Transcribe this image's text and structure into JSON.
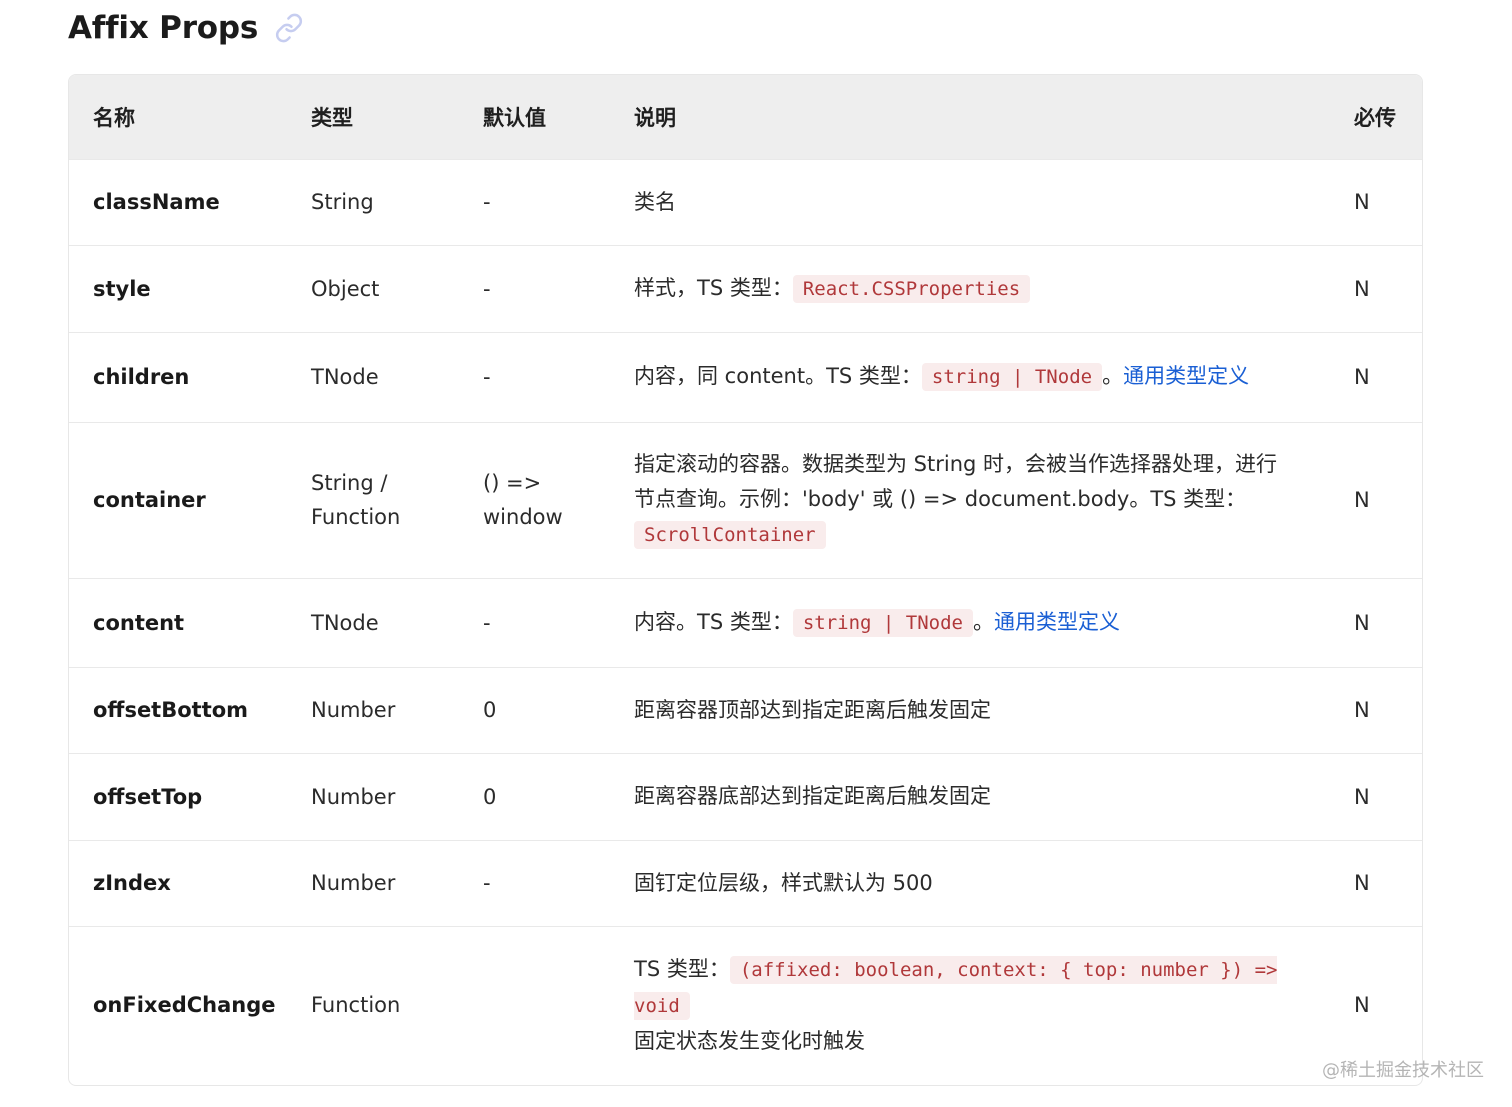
{
  "page": {
    "title": "Affix Props",
    "watermark": "@稀土掘金技术社区"
  },
  "table": {
    "headers": {
      "name": "名称",
      "type": "类型",
      "default": "默认值",
      "desc": "说明",
      "required": "必传"
    },
    "rows": [
      {
        "name": "className",
        "type": "String",
        "default": "-",
        "desc": "类名",
        "required": "N"
      },
      {
        "name": "style",
        "type": "Object",
        "default": "-",
        "desc_prefix": "样式，TS 类型：",
        "desc_code": "React.CSSProperties",
        "required": "N"
      },
      {
        "name": "children",
        "type": "TNode",
        "default": "-",
        "desc_prefix": "内容，同 content。TS 类型：",
        "desc_code": "string | TNode",
        "desc_sep": "。",
        "desc_link": "通用类型定义",
        "required": "N"
      },
      {
        "name": "container",
        "type_line1": "String /",
        "type_line2": "Function",
        "default_line1": "() =>",
        "default_line2": "window",
        "desc_prefix": "指定滚动的容器。数据类型为 String 时，会被当作选择器处理，进行节点查询。示例：'body' 或 () => document.body。TS 类型：",
        "desc_code": "ScrollContainer",
        "required": "N"
      },
      {
        "name": "content",
        "type": "TNode",
        "default": "-",
        "desc_prefix": "内容。TS 类型：",
        "desc_code": "string | TNode",
        "desc_sep": "。",
        "desc_link": "通用类型定义",
        "required": "N"
      },
      {
        "name": "offsetBottom",
        "type": "Number",
        "default": "0",
        "desc": "距离容器顶部达到指定距离后触发固定",
        "required": "N"
      },
      {
        "name": "offsetTop",
        "type": "Number",
        "default": "0",
        "desc": "距离容器底部达到指定距离后触发固定",
        "required": "N"
      },
      {
        "name": "zIndex",
        "type": "Number",
        "default": "-",
        "desc": "固钉定位层级，样式默认为 500",
        "required": "N"
      },
      {
        "name": "onFixedChange",
        "type": "Function",
        "default": "",
        "desc_prefix": "TS 类型：",
        "desc_code": "(affixed: boolean, context: { top: number }) => void",
        "desc_after": "固定状态发生变化时触发",
        "required": "N"
      }
    ]
  },
  "icons": {
    "anchor": "link-icon"
  },
  "colors": {
    "link": "#1a5fd4",
    "code_text": "#b0383a",
    "code_bg": "#f9ecec",
    "header_bg": "#eeeeee"
  }
}
